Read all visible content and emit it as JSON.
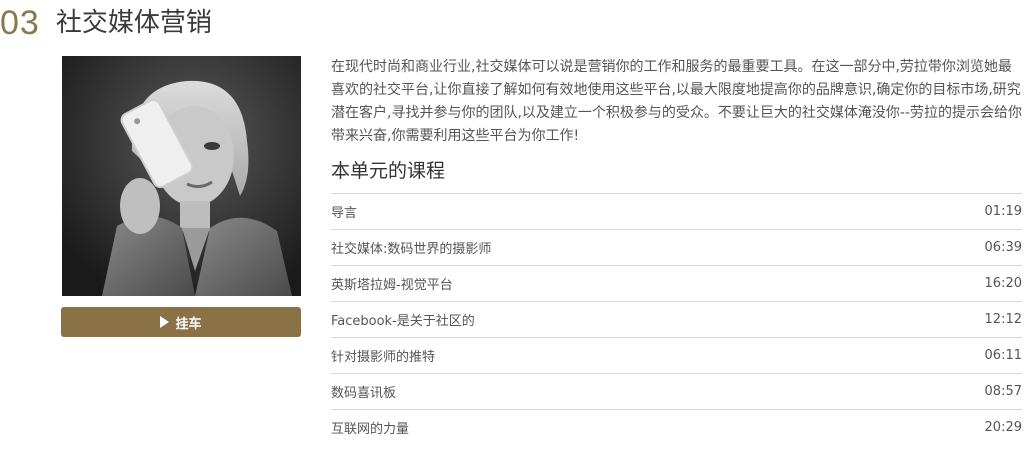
{
  "unit": {
    "number": "03",
    "title": "社交媒体营销"
  },
  "play_button": {
    "label": "挂车"
  },
  "description": "在现代时尚和商业行业,社交媒体可以说是营销你的工作和服务的最重要工具。在这一部分中,劳拉带你浏览她最喜欢的社交平台,让你直接了解如何有效地使用这些平台,以最大限度地提高你的品牌意识,确定你的目标市场,研究潜在客户,寻找并参与你的团队,以及建立一个积极参与的受众。不要让巨大的社交媒体淹没你--劳拉的提示会给你带来兴奋,你需要利用这些平台为你工作!",
  "lessons_heading": "本单元的课程",
  "lessons": [
    {
      "title": "导言",
      "duration": "01:19"
    },
    {
      "title": "社交媒体:数码世界的摄影师",
      "duration": "06:39"
    },
    {
      "title": "英斯塔拉姆-视觉平台",
      "duration": "16:20"
    },
    {
      "title": "Facebook-是关于社区的",
      "duration": "12:12"
    },
    {
      "title": "针对摄影师的推特",
      "duration": "06:11"
    },
    {
      "title": "数码喜讯板",
      "duration": "08:57"
    },
    {
      "title": "互联网的力量",
      "duration": "20:29"
    }
  ],
  "colors": {
    "accent": "#8b7246",
    "unit_number": "#8a7650"
  },
  "icons": {
    "play": "play-icon",
    "photo": "portrait-photo"
  }
}
